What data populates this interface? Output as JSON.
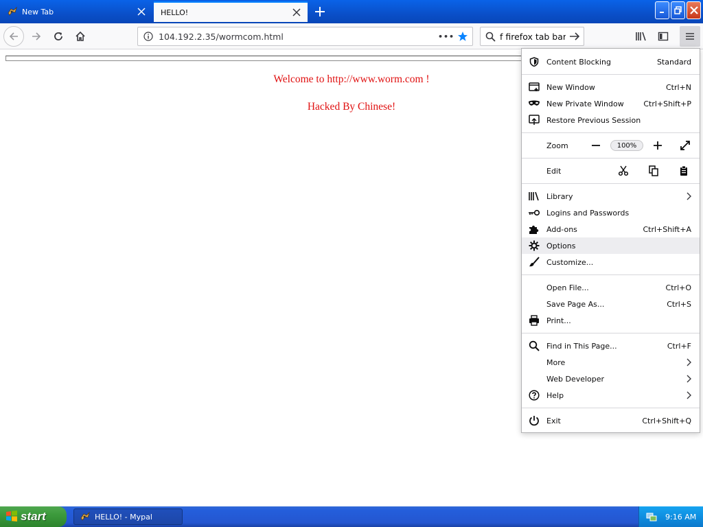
{
  "tabs": [
    {
      "title": "New Tab",
      "active": false
    },
    {
      "title": "HELLO!",
      "active": true
    }
  ],
  "navbar": {
    "url": "104.192.2.35/wormcom.html",
    "page_actions": "•••",
    "search_text": "f firefox tab bar"
  },
  "page": {
    "welcome_text": "Welcome to http://www.worm.com !",
    "hacked_text": "Hacked By Chinese!",
    "text_color": "#e01010"
  },
  "appmenu": {
    "content_blocking": {
      "label": "Content Blocking",
      "value": "Standard"
    },
    "new_window": {
      "label": "New Window",
      "shortcut": "Ctrl+N"
    },
    "new_private_window": {
      "label": "New Private Window",
      "shortcut": "Ctrl+Shift+P"
    },
    "restore_session": {
      "label": "Restore Previous Session"
    },
    "zoom": {
      "label": "Zoom",
      "level": "100%"
    },
    "edit": {
      "label": "Edit"
    },
    "library": {
      "label": "Library"
    },
    "logins": {
      "label": "Logins and Passwords"
    },
    "addons": {
      "label": "Add-ons",
      "shortcut": "Ctrl+Shift+A"
    },
    "options": {
      "label": "Options"
    },
    "customize": {
      "label": "Customize..."
    },
    "open_file": {
      "label": "Open File...",
      "shortcut": "Ctrl+O"
    },
    "save_page": {
      "label": "Save Page As...",
      "shortcut": "Ctrl+S"
    },
    "print": {
      "label": "Print..."
    },
    "find": {
      "label": "Find in This Page...",
      "shortcut": "Ctrl+F"
    },
    "more": {
      "label": "More"
    },
    "web_developer": {
      "label": "Web Developer"
    },
    "help": {
      "label": "Help"
    },
    "exit": {
      "label": "Exit",
      "shortcut": "Ctrl+Shift+Q"
    }
  },
  "taskbar": {
    "start_label": "start",
    "task_label": "HELLO! - Mypal",
    "clock": "9:16 AM"
  },
  "colors": {
    "accent": "#0a84ff",
    "tab_strip": "#0a4fc9",
    "taskbar": "#245edb",
    "start_button": "#3c9a3c"
  }
}
